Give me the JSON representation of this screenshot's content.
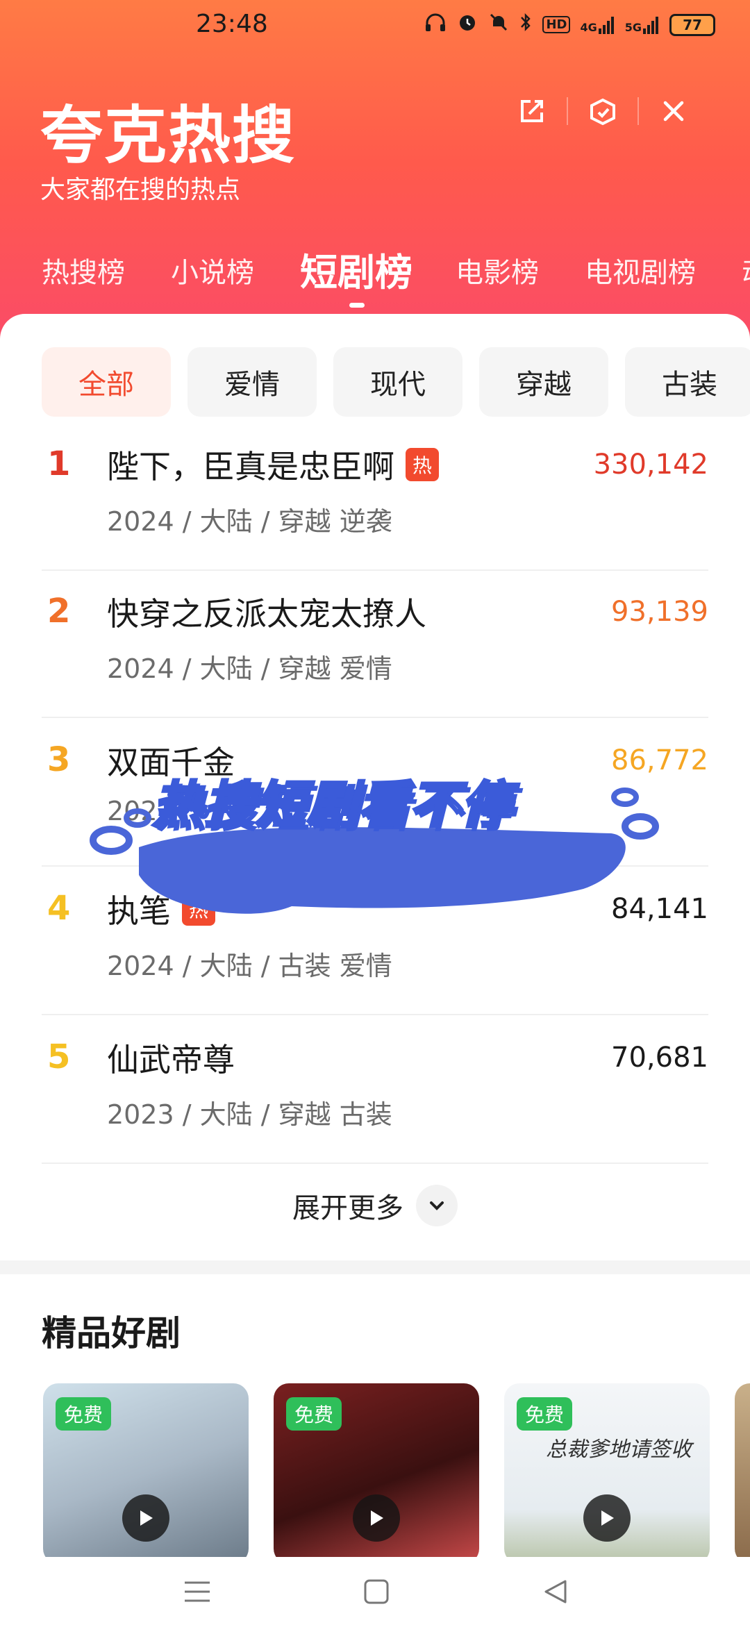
{
  "status_bar": {
    "time": "23:48",
    "icons": [
      "headphones-icon",
      "alarm-icon",
      "mute-icon",
      "bluetooth-icon",
      "hd-icon",
      "signal-4g-icon",
      "signal-5g-icon",
      "battery-icon"
    ],
    "hd_label": "HD",
    "net1": "4G",
    "net2": "5G",
    "battery": "77"
  },
  "header": {
    "title": "夸克热搜",
    "subtitle": "大家都在搜的热点",
    "actions": [
      "share-icon",
      "refresh-icon",
      "close-icon"
    ]
  },
  "tabs": [
    {
      "label": "热搜榜"
    },
    {
      "label": "小说榜"
    },
    {
      "label": "短剧榜",
      "active": true
    },
    {
      "label": "电影榜"
    },
    {
      "label": "电视剧榜"
    },
    {
      "label": "动"
    }
  ],
  "chips": [
    {
      "label": "全部",
      "active": true
    },
    {
      "label": "爱情"
    },
    {
      "label": "现代"
    },
    {
      "label": "穿越"
    },
    {
      "label": "古装"
    }
  ],
  "hot_label": "热",
  "list": [
    {
      "rank": "1",
      "title": "陛下，臣真是忠臣啊",
      "hot": true,
      "meta": "2024 / 大陆 / 穿越 逆袭",
      "heat": "330,142",
      "color": "#e03a2a"
    },
    {
      "rank": "2",
      "title": "快穿之反派太宠太撩人",
      "hot": false,
      "meta": "2024 / 大陆 / 穿越 爱情",
      "heat": "93,139",
      "color": "#f0702a"
    },
    {
      "rank": "3",
      "title": "双面千金",
      "hot": false,
      "meta": "202",
      "heat": "86,772",
      "color": "#f5a623"
    },
    {
      "rank": "4",
      "title": "执笔",
      "hot": true,
      "meta": "2024 / 大陆 / 古装 爱情",
      "heat": "84,141",
      "color": "#f5c023"
    },
    {
      "rank": "5",
      "title": "仙武帝尊",
      "hot": false,
      "meta": "2023 / 大陆 / 穿越 古装",
      "heat": "70,681",
      "color": "#f5c023"
    }
  ],
  "expand_label": "展开更多",
  "section": {
    "title": "精品好剧",
    "free_label": "免费",
    "poster3_caption": "总裁爹地请签收"
  },
  "overlay_text": "热搜短剧看不停",
  "colors": {
    "accent": "#f24a2e",
    "overlay_blue": "#3b5bd9"
  }
}
